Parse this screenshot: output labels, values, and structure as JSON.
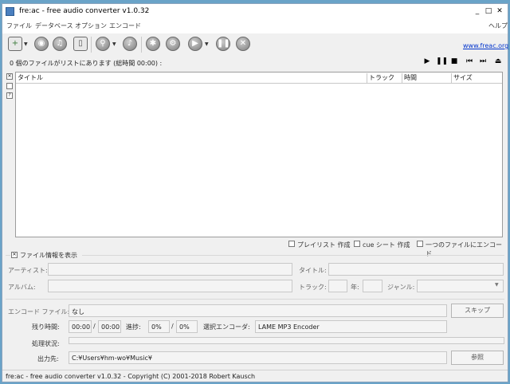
{
  "window": {
    "title": "fre:ac - free audio converter v1.0.32",
    "minimize": "_",
    "maximize": "□",
    "close": "✕"
  },
  "menu": {
    "file": "ファイル",
    "database": "データベース",
    "options": "オプション",
    "encode": "エンコード",
    "help": "ヘルプ"
  },
  "toolbar": {
    "link": "www.freac.org"
  },
  "list": {
    "status": "0 個のファイルがリストにあります (総時間 00:00) :",
    "columns": {
      "title": "タイトル",
      "track": "トラック",
      "time": "時間",
      "size": "サイズ"
    }
  },
  "options": {
    "playlist": "プレイリスト 作成",
    "cue": "cue シート 作成",
    "single_file": "一つのファイルにエンコード"
  },
  "info": {
    "toggle_label": "ファイル情報を表示",
    "artist_label": "アーティスト:",
    "title_label": "タイトル:",
    "album_label": "アルバム:",
    "track_label": "トラック:",
    "year_label": "年:",
    "genre_label": "ジャンル:"
  },
  "encode": {
    "file_label": "エンコード ファイル:",
    "file_value": "なし",
    "skip_button": "スキップ",
    "remaining_label": "残り時間:",
    "remaining_value": "00:00",
    "slash1": "/",
    "total_value": "00:00",
    "progress_label": "進捗:",
    "progress_value": "0%",
    "slash2": "/",
    "progress_total": "0%",
    "encoder_label": "選択エンコーダ:",
    "encoder_value": "LAME MP3 Encoder",
    "status_label": "処理状況:",
    "output_label": "出力先:",
    "output_value": "C:¥Users¥hm-wo¥Music¥",
    "browse_button": "参照"
  },
  "footer": "fre:ac - free audio converter v1.0.32 - Copyright (C) 2001-2018 Robert Kausch"
}
